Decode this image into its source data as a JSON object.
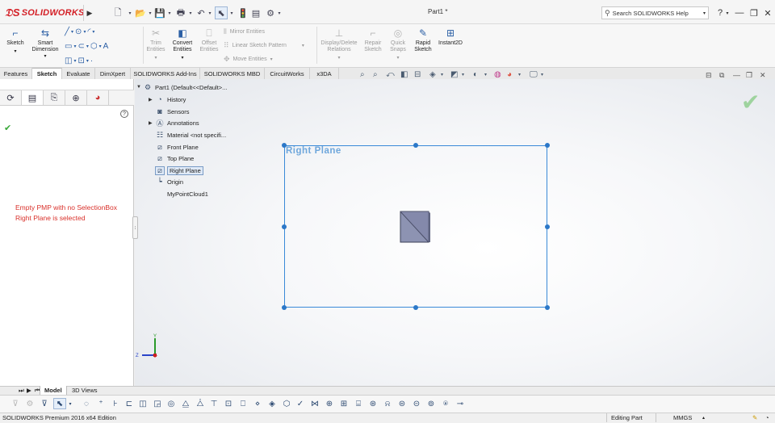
{
  "app": {
    "brand": "SOLIDWORKS",
    "window_title": "Part1 *",
    "search_placeholder": "Search SOLIDWORKS Help"
  },
  "command_manager": {
    "big_tools": [
      {
        "id": "sketch",
        "label": "Sketch",
        "enabled": true
      },
      {
        "id": "smart-dimension",
        "label": "Smart Dimension",
        "enabled": true
      },
      {
        "id": "trim-entities",
        "label": "Trim Entities",
        "enabled": false
      },
      {
        "id": "convert-entities",
        "label": "Convert Entities",
        "enabled": true
      },
      {
        "id": "offset-entities",
        "label": "Offset Entities",
        "enabled": false
      },
      {
        "id": "display-delete-relations",
        "label": "Display/Delete Relations",
        "enabled": false
      },
      {
        "id": "repair-sketch",
        "label": "Repair Sketch",
        "enabled": false
      },
      {
        "id": "quick-snaps",
        "label": "Quick Snaps",
        "enabled": false
      },
      {
        "id": "rapid-sketch",
        "label": "Rapid Sketch",
        "enabled": true
      },
      {
        "id": "instant2d",
        "label": "Instant2D",
        "enabled": true
      }
    ],
    "mirror_entities": "Mirror Entities",
    "linear_sketch_pattern": "Linear Sketch Pattern",
    "move_entities": "Move Entities"
  },
  "tabs": [
    {
      "label": "Features",
      "active": false
    },
    {
      "label": "Sketch",
      "active": true
    },
    {
      "label": "Evaluate",
      "active": false
    },
    {
      "label": "DimXpert",
      "active": false
    },
    {
      "label": "SOLIDWORKS Add-Ins",
      "active": false
    },
    {
      "label": "SOLIDWORKS MBD",
      "active": false
    },
    {
      "label": "CircuitWorks",
      "active": false
    },
    {
      "label": "x3DA",
      "active": false
    }
  ],
  "property_manager": {
    "help_symbol": "?",
    "message_line1": "Empty PMP with no SelectionBox",
    "message_line2": "Right Plane is selected"
  },
  "feature_tree": {
    "root": "Part1  (Default<<Default>...",
    "items": [
      {
        "label": "History",
        "icon": "history-icon",
        "expandable": true
      },
      {
        "label": "Sensors",
        "icon": "sensors-icon",
        "expandable": false
      },
      {
        "label": "Annotations",
        "icon": "annotations-icon",
        "expandable": true
      },
      {
        "label": "Material <not specifi...",
        "icon": "material-icon",
        "expandable": false
      },
      {
        "label": "Front Plane",
        "icon": "plane-icon",
        "expandable": false
      },
      {
        "label": "Top Plane",
        "icon": "plane-icon",
        "expandable": false
      },
      {
        "label": "Right Plane",
        "icon": "plane-icon",
        "expandable": false,
        "selected": true
      },
      {
        "label": "Origin",
        "icon": "origin-icon",
        "expandable": false
      },
      {
        "label": "MyPointCloud1",
        "icon": "",
        "expandable": false
      }
    ]
  },
  "viewport": {
    "plane_label": "Right Plane",
    "triad_y": "Y",
    "triad_z": "Z",
    "plane_color": "#3a8ad8"
  },
  "bottom_tabs": [
    {
      "label": "Model",
      "active": true
    },
    {
      "label": "3D Views",
      "active": false
    }
  ],
  "status": {
    "edition": "SOLIDWORKS Premium 2016 x64 Edition",
    "mode": "Editing Part",
    "units": "MMGS"
  }
}
